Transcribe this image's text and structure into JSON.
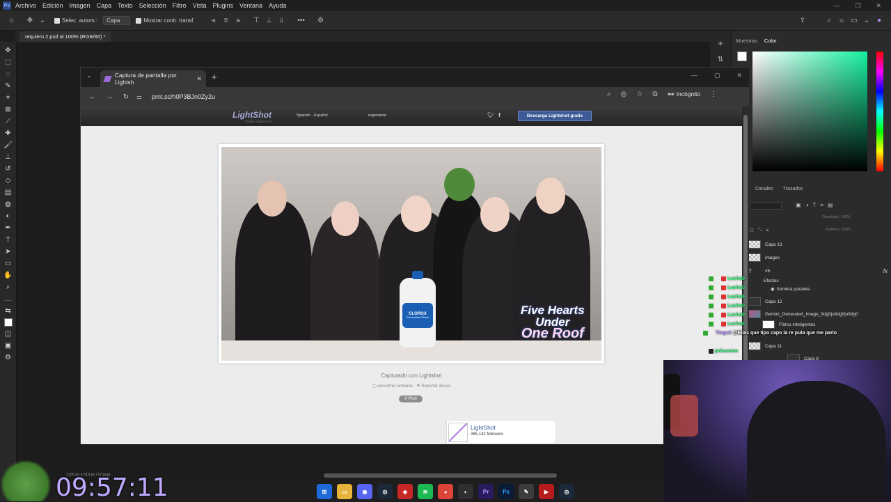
{
  "photoshop": {
    "menu": [
      "Archivo",
      "Edición",
      "Imagen",
      "Capa",
      "Texto",
      "Selección",
      "Filtro",
      "Vista",
      "Plugins",
      "Ventana",
      "Ayuda"
    ],
    "options": {
      "auto_select_label": "Selec. autom.:",
      "auto_select_value": "Capa",
      "show_transform_label": "Mostrar contr. transf."
    },
    "doc_tab": "requiem 2.psd al 100% (RGB/8#) *",
    "doc_info": "1100 px x 619 px (72 ppp)",
    "panels": {
      "tabs": [
        "Muestras",
        "Color"
      ],
      "active_tab": "Color",
      "layers_tabs": [
        "Canales",
        "Trazados"
      ],
      "opacity_label": "Opacidad:",
      "opacity_value": "100%",
      "fill_label": "Relleno:",
      "fill_value": "100%",
      "fx_label": "fx",
      "layers": [
        "Capa 13",
        "images",
        "#5",
        "Efectos",
        "Sombra paralela",
        "Capa 12",
        "Gemini_Generated_Image_9dg0ju9dg0ju9dg0",
        "Filtros inteligentes",
        "Capa 11",
        "Capa 8"
      ]
    },
    "colors": {
      "accent": "#16f0a0"
    }
  },
  "browser": {
    "tab_title": "Captura de pantalla por Lightsh",
    "url": "prnt.sc/h0P3BJn0Zy2u",
    "incognito_label": "Incógnito"
  },
  "lightshot": {
    "logo": "LightShot",
    "logo_sub": "screen capture tool",
    "language": "Spanish - Español",
    "register": "registrarse",
    "download_button": "Descarga Lightshot gratis",
    "caption": "Capturado con Lightshot",
    "find_similar": "encontrar similares",
    "report_abuse": "Reportar abuso",
    "post_button": "X Post",
    "fb_name": "LightShot",
    "fb_followers": "385,142 followers",
    "photo": {
      "bleach_brand": "CLOROX",
      "bleach_sub": "Concentrated Bleach",
      "show_title_1": "Five Hearts",
      "show_title_2": "Under",
      "show_title_3": "One Roof"
    }
  },
  "chat": {
    "lines": [
      {
        "name": "Lucho0",
        "msg": ""
      },
      {
        "name": "Lucho0",
        "msg": ""
      },
      {
        "name": "Lucho0",
        "msg": ""
      },
      {
        "name": "Lucho0",
        "msg": ""
      },
      {
        "name": "Lucho0",
        "msg": ""
      },
      {
        "name": "Lucho0",
        "msg": ""
      }
    ],
    "highlight_user": "Tingu0",
    "highlight_msg": "@Elías que tipo capo la re puta que me pario",
    "last_user": "pelusomo"
  },
  "overlay": {
    "clock": "09:57:11"
  },
  "taskbar": {
    "apps": [
      "windows-start",
      "file-explorer",
      "discord",
      "steam",
      "app-red",
      "spotify",
      "chrome",
      "obs",
      "premiere",
      "photoshop",
      "lightshot",
      "app-video",
      "steam-2"
    ]
  }
}
